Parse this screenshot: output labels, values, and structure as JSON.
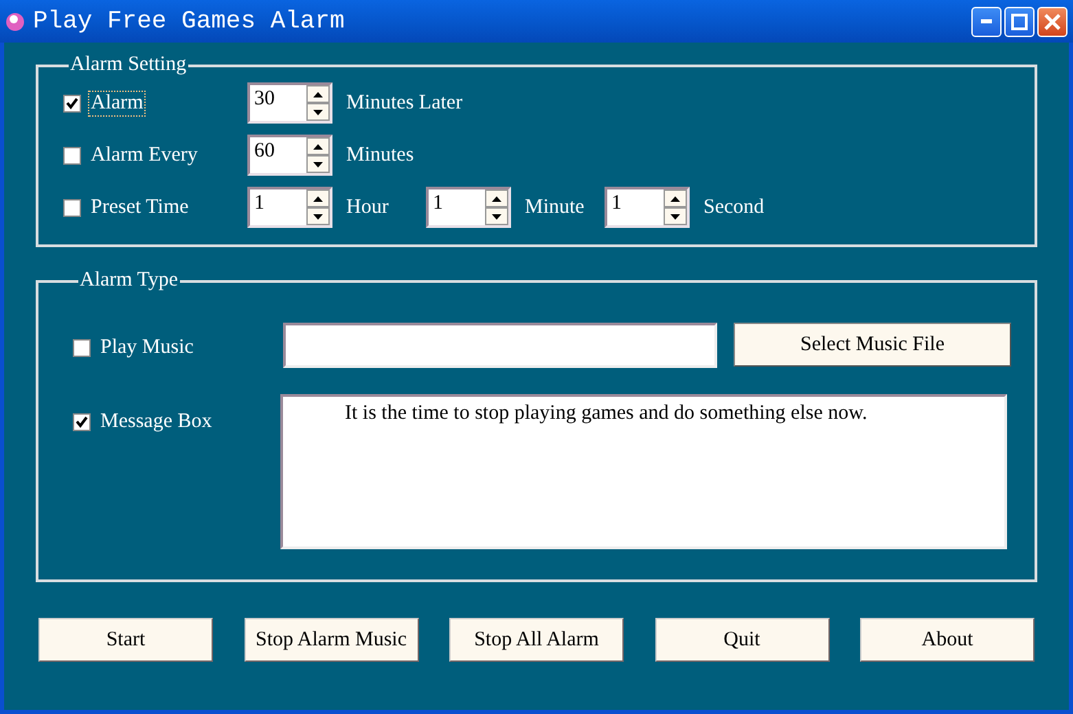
{
  "window": {
    "title": "Play Free Games Alarm"
  },
  "alarm_setting": {
    "title": "Alarm Setting",
    "rows": [
      {
        "label": "Alarm",
        "checked": true,
        "focused": true,
        "fields": [
          {
            "value": "30",
            "unit": "Minutes Later"
          }
        ]
      },
      {
        "label": "Alarm Every",
        "checked": false,
        "focused": false,
        "fields": [
          {
            "value": "60",
            "unit": "Minutes"
          }
        ]
      },
      {
        "label": "Preset Time",
        "checked": false,
        "focused": false,
        "fields": [
          {
            "value": "1",
            "unit": "Hour"
          },
          {
            "value": "1",
            "unit": "Minute"
          },
          {
            "value": "1",
            "unit": "Second"
          }
        ]
      }
    ]
  },
  "alarm_type": {
    "title": "Alarm Type",
    "play_music": {
      "label": "Play Music",
      "checked": false,
      "button": "Select Music File"
    },
    "message_box": {
      "label": "Message Box",
      "checked": true,
      "value": "It is the time to stop playing games and do something else now."
    }
  },
  "buttons": [
    "Start",
    "Stop Alarm Music",
    "Stop All Alarm",
    "Quit",
    "About"
  ]
}
